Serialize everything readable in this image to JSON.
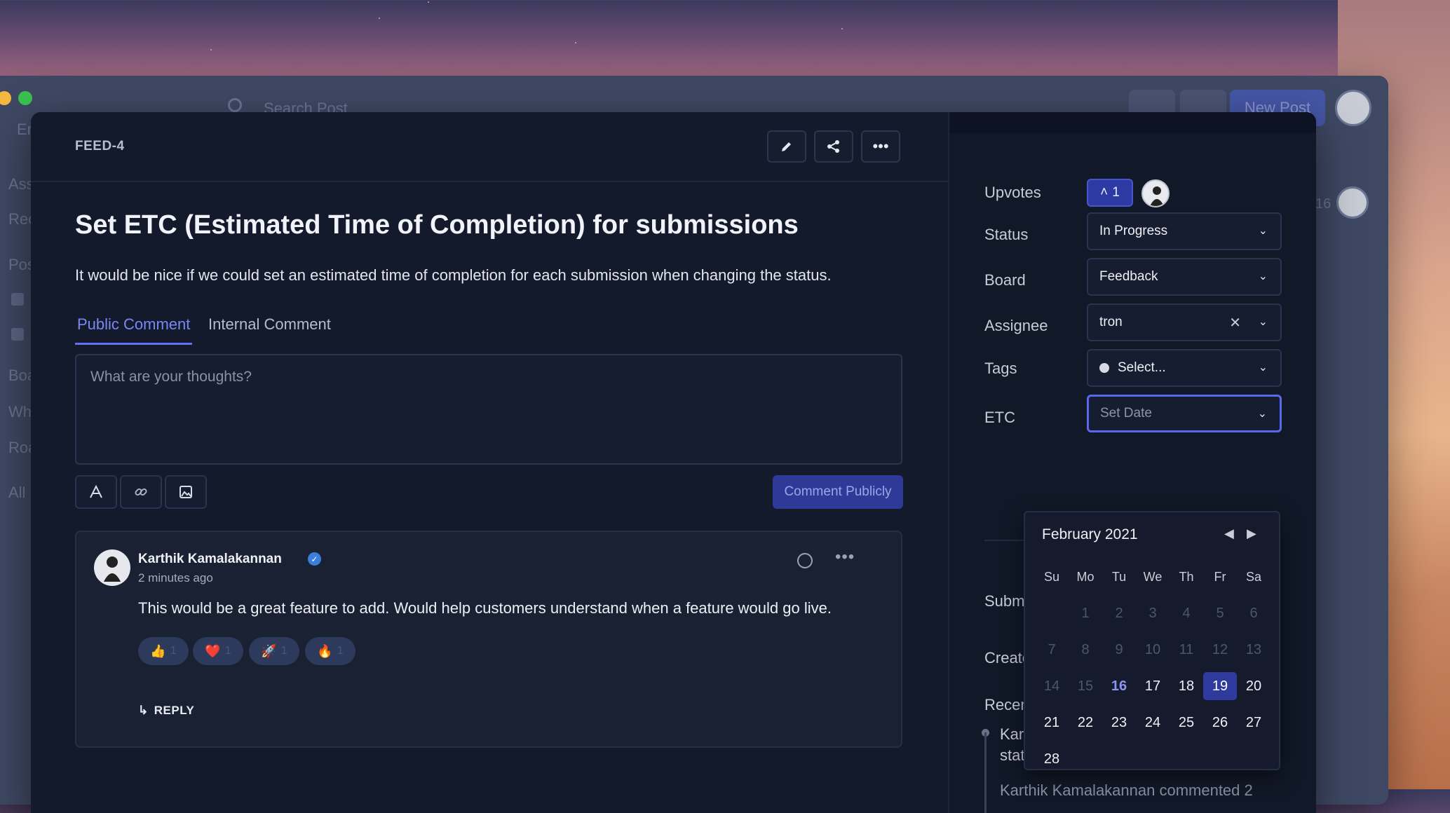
{
  "background_window": {
    "search_placeholder": "Search Post",
    "new_post_label": "New Post",
    "sidebar_fragments": [
      "Er",
      "Ass",
      "Rec",
      "Pos",
      "Boa",
      "Wh",
      "Roa",
      "All"
    ],
    "count_fragment": "16"
  },
  "post": {
    "feed_id": "FEED-4",
    "title": "Set ETC (Estimated Time of Completion) for submissions",
    "description": "It would be nice if we could set an estimated time of completion for each submission when changing the status."
  },
  "toolbar": {
    "edit_icon": "pencil-icon",
    "share_icon": "share-icon",
    "more_icon": "more-horizontal-icon"
  },
  "tabs": [
    {
      "label": "Public Comment",
      "active": true
    },
    {
      "label": "Internal Comment",
      "active": false
    }
  ],
  "composer": {
    "placeholder": "What are your thoughts?",
    "submit_label": "Comment Publicly",
    "format_icons": [
      "text-format-icon",
      "link-icon",
      "image-icon"
    ]
  },
  "comment": {
    "author": "Karthik Kamalakannan",
    "verified": true,
    "time": "2 minutes ago",
    "text": "This would be a great feature to add. Would help customers understand when a feature would go live.",
    "reactions": [
      {
        "emoji": "👍",
        "count": "1"
      },
      {
        "emoji": "❤️",
        "count": "1"
      },
      {
        "emoji": "🚀",
        "count": "1"
      },
      {
        "emoji": "🔥",
        "count": "1"
      }
    ],
    "reply_label": "REPLY"
  },
  "details": {
    "upvotes_label": "Upvotes",
    "upvote_count": "1",
    "status_label": "Status",
    "status_value": "In Progress",
    "board_label": "Board",
    "board_value": "Feedback",
    "assignee_label": "Assignee",
    "assignee_value": "tron",
    "tags_label": "Tags",
    "tags_placeholder": "Select...",
    "etc_label": "ETC",
    "etc_placeholder": "Set Date",
    "partial_labels": [
      "Submi",
      "Create",
      "Recen",
      "Kart",
      "stat"
    ],
    "partial_activity": "Karthik Kamalakannan commented 2"
  },
  "calendar": {
    "month_label": "February 2021",
    "weekdays": [
      "Su",
      "Mo",
      "Tu",
      "We",
      "Th",
      "Fr",
      "Sa"
    ],
    "today": "16",
    "selected": "19",
    "days": [
      {
        "d": "",
        "s": "dim"
      },
      {
        "d": "1",
        "s": "dim"
      },
      {
        "d": "2",
        "s": "dim"
      },
      {
        "d": "3",
        "s": "dim"
      },
      {
        "d": "4",
        "s": "dim"
      },
      {
        "d": "5",
        "s": "dim"
      },
      {
        "d": "6",
        "s": "dim"
      },
      {
        "d": "7",
        "s": "dim"
      },
      {
        "d": "8",
        "s": "dim"
      },
      {
        "d": "9",
        "s": "dim"
      },
      {
        "d": "10",
        "s": "dim"
      },
      {
        "d": "11",
        "s": "dim"
      },
      {
        "d": "12",
        "s": "dim"
      },
      {
        "d": "13",
        "s": "dim"
      },
      {
        "d": "14",
        "s": "dim"
      },
      {
        "d": "15",
        "s": "dim"
      },
      {
        "d": "16",
        "s": "today"
      },
      {
        "d": "17",
        "s": "norm"
      },
      {
        "d": "18",
        "s": "norm"
      },
      {
        "d": "19",
        "s": "sel"
      },
      {
        "d": "20",
        "s": "norm"
      },
      {
        "d": "21",
        "s": "norm"
      },
      {
        "d": "22",
        "s": "norm"
      },
      {
        "d": "23",
        "s": "norm"
      },
      {
        "d": "24",
        "s": "norm"
      },
      {
        "d": "25",
        "s": "norm"
      },
      {
        "d": "26",
        "s": "norm"
      },
      {
        "d": "27",
        "s": "norm"
      },
      {
        "d": "28",
        "s": "norm"
      }
    ]
  },
  "colors": {
    "accent": "#6370f0",
    "selected_day": "#2f3a9e",
    "panel_bg": "#131a2c"
  }
}
